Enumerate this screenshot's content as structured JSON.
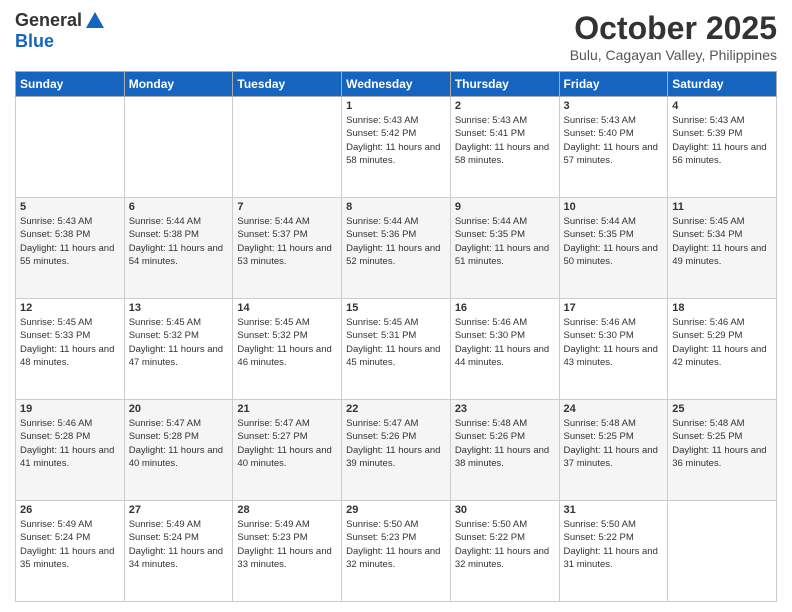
{
  "header": {
    "logo_line1": "General",
    "logo_line2": "Blue",
    "month": "October 2025",
    "location": "Bulu, Cagayan Valley, Philippines"
  },
  "weekdays": [
    "Sunday",
    "Monday",
    "Tuesday",
    "Wednesday",
    "Thursday",
    "Friday",
    "Saturday"
  ],
  "weeks": [
    [
      {
        "day": "",
        "sunrise": "",
        "sunset": "",
        "daylight": ""
      },
      {
        "day": "",
        "sunrise": "",
        "sunset": "",
        "daylight": ""
      },
      {
        "day": "",
        "sunrise": "",
        "sunset": "",
        "daylight": ""
      },
      {
        "day": "1",
        "sunrise": "Sunrise: 5:43 AM",
        "sunset": "Sunset: 5:42 PM",
        "daylight": "Daylight: 11 hours and 58 minutes."
      },
      {
        "day": "2",
        "sunrise": "Sunrise: 5:43 AM",
        "sunset": "Sunset: 5:41 PM",
        "daylight": "Daylight: 11 hours and 58 minutes."
      },
      {
        "day": "3",
        "sunrise": "Sunrise: 5:43 AM",
        "sunset": "Sunset: 5:40 PM",
        "daylight": "Daylight: 11 hours and 57 minutes."
      },
      {
        "day": "4",
        "sunrise": "Sunrise: 5:43 AM",
        "sunset": "Sunset: 5:39 PM",
        "daylight": "Daylight: 11 hours and 56 minutes."
      }
    ],
    [
      {
        "day": "5",
        "sunrise": "Sunrise: 5:43 AM",
        "sunset": "Sunset: 5:38 PM",
        "daylight": "Daylight: 11 hours and 55 minutes."
      },
      {
        "day": "6",
        "sunrise": "Sunrise: 5:44 AM",
        "sunset": "Sunset: 5:38 PM",
        "daylight": "Daylight: 11 hours and 54 minutes."
      },
      {
        "day": "7",
        "sunrise": "Sunrise: 5:44 AM",
        "sunset": "Sunset: 5:37 PM",
        "daylight": "Daylight: 11 hours and 53 minutes."
      },
      {
        "day": "8",
        "sunrise": "Sunrise: 5:44 AM",
        "sunset": "Sunset: 5:36 PM",
        "daylight": "Daylight: 11 hours and 52 minutes."
      },
      {
        "day": "9",
        "sunrise": "Sunrise: 5:44 AM",
        "sunset": "Sunset: 5:35 PM",
        "daylight": "Daylight: 11 hours and 51 minutes."
      },
      {
        "day": "10",
        "sunrise": "Sunrise: 5:44 AM",
        "sunset": "Sunset: 5:35 PM",
        "daylight": "Daylight: 11 hours and 50 minutes."
      },
      {
        "day": "11",
        "sunrise": "Sunrise: 5:45 AM",
        "sunset": "Sunset: 5:34 PM",
        "daylight": "Daylight: 11 hours and 49 minutes."
      }
    ],
    [
      {
        "day": "12",
        "sunrise": "Sunrise: 5:45 AM",
        "sunset": "Sunset: 5:33 PM",
        "daylight": "Daylight: 11 hours and 48 minutes."
      },
      {
        "day": "13",
        "sunrise": "Sunrise: 5:45 AM",
        "sunset": "Sunset: 5:32 PM",
        "daylight": "Daylight: 11 hours and 47 minutes."
      },
      {
        "day": "14",
        "sunrise": "Sunrise: 5:45 AM",
        "sunset": "Sunset: 5:32 PM",
        "daylight": "Daylight: 11 hours and 46 minutes."
      },
      {
        "day": "15",
        "sunrise": "Sunrise: 5:45 AM",
        "sunset": "Sunset: 5:31 PM",
        "daylight": "Daylight: 11 hours and 45 minutes."
      },
      {
        "day": "16",
        "sunrise": "Sunrise: 5:46 AM",
        "sunset": "Sunset: 5:30 PM",
        "daylight": "Daylight: 11 hours and 44 minutes."
      },
      {
        "day": "17",
        "sunrise": "Sunrise: 5:46 AM",
        "sunset": "Sunset: 5:30 PM",
        "daylight": "Daylight: 11 hours and 43 minutes."
      },
      {
        "day": "18",
        "sunrise": "Sunrise: 5:46 AM",
        "sunset": "Sunset: 5:29 PM",
        "daylight": "Daylight: 11 hours and 42 minutes."
      }
    ],
    [
      {
        "day": "19",
        "sunrise": "Sunrise: 5:46 AM",
        "sunset": "Sunset: 5:28 PM",
        "daylight": "Daylight: 11 hours and 41 minutes."
      },
      {
        "day": "20",
        "sunrise": "Sunrise: 5:47 AM",
        "sunset": "Sunset: 5:28 PM",
        "daylight": "Daylight: 11 hours and 40 minutes."
      },
      {
        "day": "21",
        "sunrise": "Sunrise: 5:47 AM",
        "sunset": "Sunset: 5:27 PM",
        "daylight": "Daylight: 11 hours and 40 minutes."
      },
      {
        "day": "22",
        "sunrise": "Sunrise: 5:47 AM",
        "sunset": "Sunset: 5:26 PM",
        "daylight": "Daylight: 11 hours and 39 minutes."
      },
      {
        "day": "23",
        "sunrise": "Sunrise: 5:48 AM",
        "sunset": "Sunset: 5:26 PM",
        "daylight": "Daylight: 11 hours and 38 minutes."
      },
      {
        "day": "24",
        "sunrise": "Sunrise: 5:48 AM",
        "sunset": "Sunset: 5:25 PM",
        "daylight": "Daylight: 11 hours and 37 minutes."
      },
      {
        "day": "25",
        "sunrise": "Sunrise: 5:48 AM",
        "sunset": "Sunset: 5:25 PM",
        "daylight": "Daylight: 11 hours and 36 minutes."
      }
    ],
    [
      {
        "day": "26",
        "sunrise": "Sunrise: 5:49 AM",
        "sunset": "Sunset: 5:24 PM",
        "daylight": "Daylight: 11 hours and 35 minutes."
      },
      {
        "day": "27",
        "sunrise": "Sunrise: 5:49 AM",
        "sunset": "Sunset: 5:24 PM",
        "daylight": "Daylight: 11 hours and 34 minutes."
      },
      {
        "day": "28",
        "sunrise": "Sunrise: 5:49 AM",
        "sunset": "Sunset: 5:23 PM",
        "daylight": "Daylight: 11 hours and 33 minutes."
      },
      {
        "day": "29",
        "sunrise": "Sunrise: 5:50 AM",
        "sunset": "Sunset: 5:23 PM",
        "daylight": "Daylight: 11 hours and 32 minutes."
      },
      {
        "day": "30",
        "sunrise": "Sunrise: 5:50 AM",
        "sunset": "Sunset: 5:22 PM",
        "daylight": "Daylight: 11 hours and 32 minutes."
      },
      {
        "day": "31",
        "sunrise": "Sunrise: 5:50 AM",
        "sunset": "Sunset: 5:22 PM",
        "daylight": "Daylight: 11 hours and 31 minutes."
      },
      {
        "day": "",
        "sunrise": "",
        "sunset": "",
        "daylight": ""
      }
    ]
  ]
}
